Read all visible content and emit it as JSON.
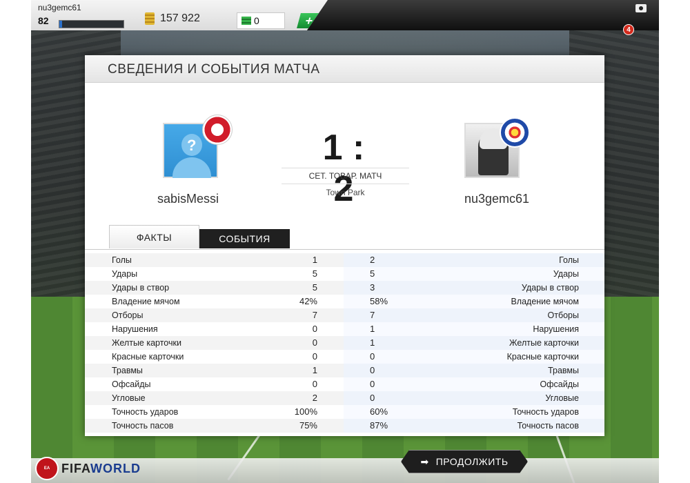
{
  "topbar": {
    "username": "nu3gemc61",
    "level": "82",
    "xp_progress": 0.04,
    "coins": "157 922",
    "cash": "0",
    "plus_label": "+",
    "notifications": "4"
  },
  "panel": {
    "title": "СВЕДЕНИЯ И СОБЫТИЯ МАТЧА",
    "home_team": "sabisMessi",
    "away_team": "nu3gemc61",
    "score": "1 : 2",
    "match_type": "СЕТ. ТОВАР. МАТЧ",
    "venue": "Town Park",
    "tabs": [
      {
        "label": "ФАКТЫ",
        "active": true
      },
      {
        "label": "СОБЫТИЯ",
        "active": false
      }
    ]
  },
  "stats": [
    {
      "label": "Голы",
      "home": "1",
      "away": "2"
    },
    {
      "label": "Удары",
      "home": "5",
      "away": "5"
    },
    {
      "label": "Удары в створ",
      "home": "5",
      "away": "3"
    },
    {
      "label": "Владение мячом",
      "home": "42%",
      "away": "58%"
    },
    {
      "label": "Отборы",
      "home": "7",
      "away": "7"
    },
    {
      "label": "Нарушения",
      "home": "0",
      "away": "1"
    },
    {
      "label": "Желтые карточки",
      "home": "0",
      "away": "1"
    },
    {
      "label": "Красные карточки",
      "home": "0",
      "away": "0"
    },
    {
      "label": "Травмы",
      "home": "1",
      "away": "0"
    },
    {
      "label": "Офсайды",
      "home": "0",
      "away": "0"
    },
    {
      "label": "Угловые",
      "home": "2",
      "away": "0"
    },
    {
      "label": "Точность ударов",
      "home": "100%",
      "away": "60%"
    },
    {
      "label": "Точность пасов",
      "home": "75%",
      "away": "87%"
    }
  ],
  "bottombar": {
    "ea_logo": "EA SPORTS",
    "brand_fifa": "FIFA",
    "brand_world": "WORLD",
    "continue_label": "ПРОДОЛЖИТЬ"
  },
  "colors": {
    "accent_blue": "#2b6fc8",
    "cash_green": "#148a30",
    "badge_red": "#d32a1c"
  }
}
